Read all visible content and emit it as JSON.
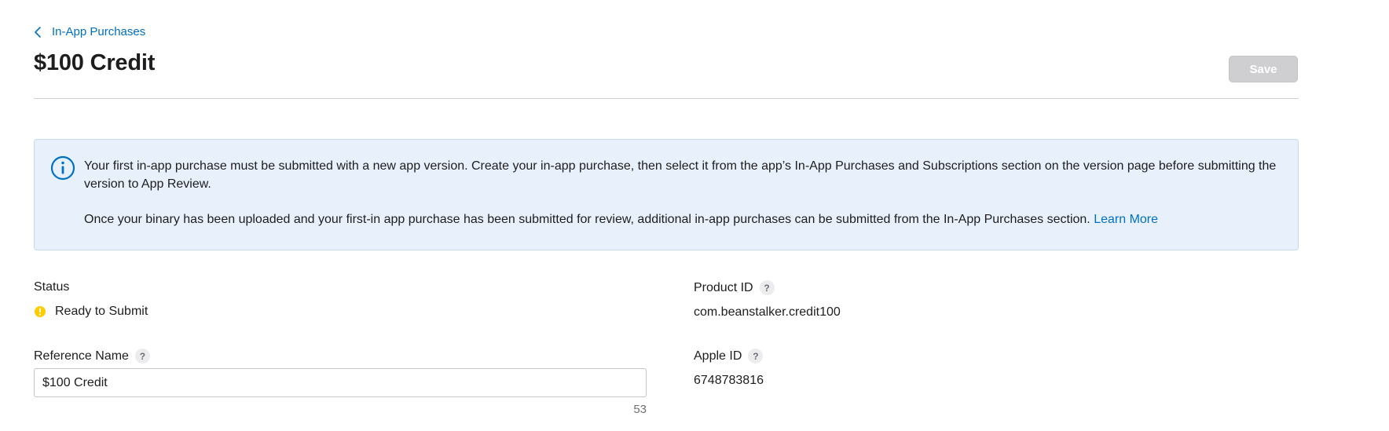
{
  "breadcrumb": {
    "label": "In-App Purchases",
    "icon": "chevron-left-icon"
  },
  "page": {
    "title": "$100 Credit",
    "save_label": "Save"
  },
  "info_banner": {
    "icon": "info-circle-icon",
    "paragraph1": "Your first in-app purchase must be submitted with a new app version. Create your in-app purchase, then select it from the app’s In-App Purchases and Subscriptions section on the version page before submitting the version to App Review.",
    "paragraph2": "Once your binary has been uploaded and your first-in app purchase has been submitted for review, additional in-app purchases can be submitted from the In-App Purchases section.",
    "learn_more": "Learn More"
  },
  "fields": {
    "status": {
      "label": "Status",
      "value": "Ready to Submit",
      "status_color": "#ffcc00"
    },
    "product_id": {
      "label": "Product ID",
      "help": "?",
      "value": "com.beanstalker.credit100"
    },
    "reference_name": {
      "label": "Reference Name",
      "help": "?",
      "value": "$100 Credit",
      "char_remaining": "53"
    },
    "apple_id": {
      "label": "Apple ID",
      "help": "?",
      "value": "6748783816"
    }
  },
  "colors": {
    "accent": "#0070c9",
    "banner_bg": "#e8f1fb",
    "save_disabled": "#cfcfd1"
  }
}
